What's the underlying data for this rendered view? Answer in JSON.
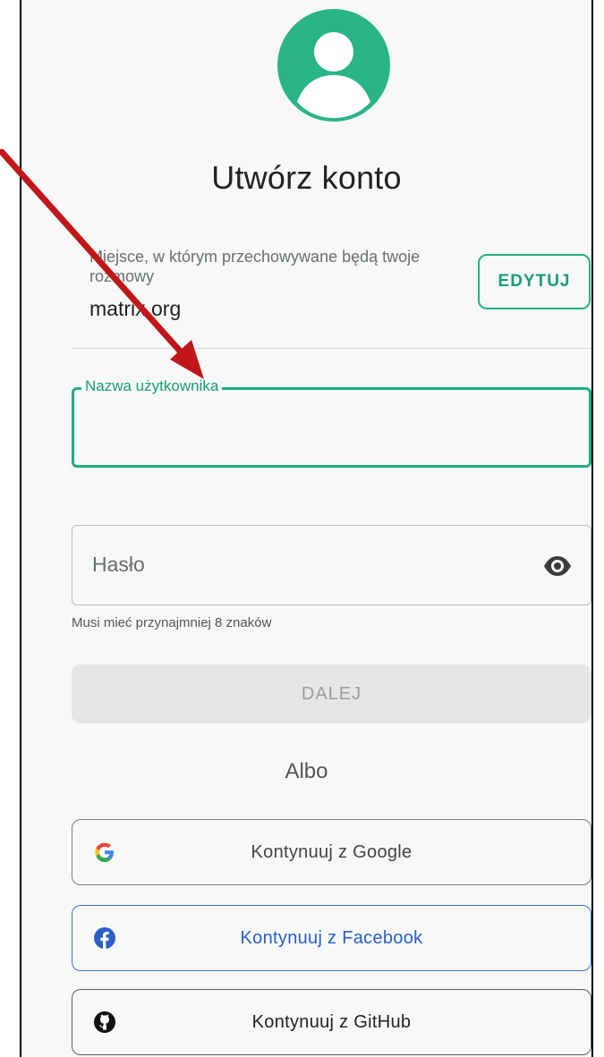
{
  "title": "Utwórz konto",
  "server": {
    "description": "Miejsce, w którym przechowywane będą twoje rozmowy",
    "name": "matrix.org",
    "edit_label": "EDYTUJ"
  },
  "username": {
    "label": "Nazwa użytkownika",
    "value": ""
  },
  "password": {
    "placeholder": "Hasło",
    "helper": "Musi mieć przynajmniej 8 znaków"
  },
  "next_label": "DALEJ",
  "or_label": "Albo",
  "social": {
    "google_label": "Kontynuuj z Google",
    "facebook_label": "Kontynuuj z Facebook",
    "github_label": "Kontynuuj z GitHub"
  },
  "icons": [
    "avatar-icon",
    "eye-icon",
    "google-icon",
    "facebook-icon",
    "github-icon"
  ],
  "colors": {
    "accent": "#1fae80",
    "facebook": "#2a5fc8",
    "annotation_arrow": "#c0171a"
  }
}
